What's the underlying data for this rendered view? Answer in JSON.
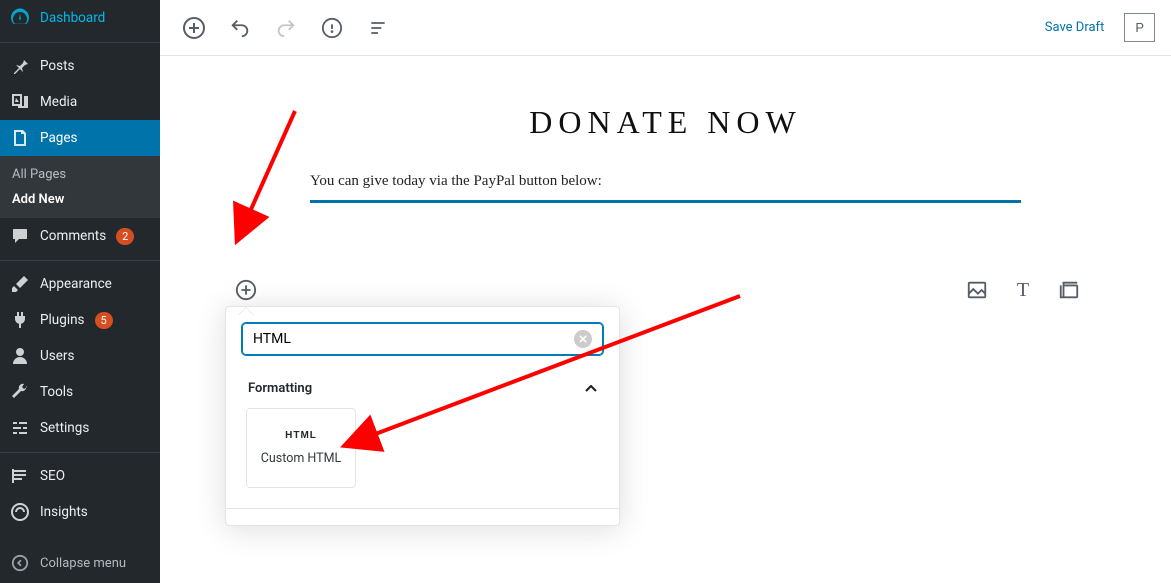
{
  "sidebar": {
    "items": [
      {
        "label": "Dashboard",
        "icon": "dashboard"
      },
      {
        "label": "Posts",
        "icon": "pin"
      },
      {
        "label": "Media",
        "icon": "media"
      },
      {
        "label": "Pages",
        "icon": "pages",
        "active": true
      },
      {
        "label": "Comments",
        "icon": "comment",
        "badge": "2"
      },
      {
        "label": "Appearance",
        "icon": "brush"
      },
      {
        "label": "Plugins",
        "icon": "plug",
        "badge": "5"
      },
      {
        "label": "Users",
        "icon": "user"
      },
      {
        "label": "Tools",
        "icon": "wrench"
      },
      {
        "label": "Settings",
        "icon": "sliders"
      },
      {
        "label": "SEO",
        "icon": "seo"
      },
      {
        "label": "Insights",
        "icon": "insights"
      }
    ],
    "submenu": {
      "all_pages": "All Pages",
      "add_new": "Add New"
    },
    "collapse_label": "Collapse menu"
  },
  "toolbar": {
    "save_draft": "Save Draft",
    "preview_initial": "P"
  },
  "page": {
    "title": "DONATE NOW",
    "paragraph": "You can give today via the PayPal button below:"
  },
  "inserter": {
    "search_value": "HTML",
    "category": "Formatting",
    "block": {
      "icon_text": "HTML",
      "label": "Custom HTML"
    }
  }
}
